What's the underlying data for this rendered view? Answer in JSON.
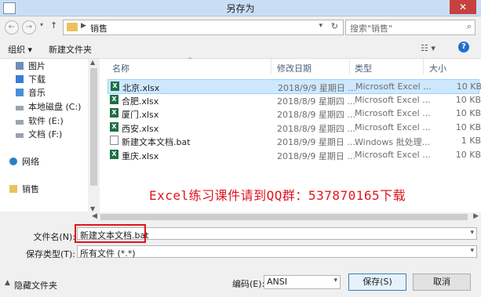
{
  "window": {
    "title": "另存为",
    "close_glyph": "✕"
  },
  "address": {
    "crumb": "销售",
    "search_placeholder": "搜索\"销售\""
  },
  "toolbar": {
    "organize": "组织 ▾",
    "new_folder": "新建文件夹"
  },
  "sidebar": {
    "items": [
      {
        "label": "图片",
        "icon": "pictures-icon"
      },
      {
        "label": "下载",
        "icon": "downloads-icon"
      },
      {
        "label": "音乐",
        "icon": "music-icon"
      },
      {
        "label": "本地磁盘 (C:)",
        "icon": "drive-icon"
      },
      {
        "label": "软件 (E:)",
        "icon": "drive-icon"
      },
      {
        "label": "文档 (F:)",
        "icon": "drive-icon"
      },
      {
        "label": "网络",
        "icon": "network-icon"
      },
      {
        "label": "销售",
        "icon": "folder-icon"
      }
    ]
  },
  "columns": {
    "name": "名称",
    "date": "修改日期",
    "type": "类型",
    "size": "大小"
  },
  "files": [
    {
      "name": "北京.xlsx",
      "date": "2018/9/9 星期日 ...",
      "type": "Microsoft Excel ...",
      "size": "10 KB",
      "kind": "excel",
      "selected": true
    },
    {
      "name": "合肥.xlsx",
      "date": "2018/8/9 星期四 ...",
      "type": "Microsoft Excel ...",
      "size": "10 KB",
      "kind": "excel"
    },
    {
      "name": "厦门.xlsx",
      "date": "2018/8/9 星期四 ...",
      "type": "Microsoft Excel ...",
      "size": "10 KB",
      "kind": "excel"
    },
    {
      "name": "西安.xlsx",
      "date": "2018/8/9 星期四 ...",
      "type": "Microsoft Excel ...",
      "size": "10 KB",
      "kind": "excel"
    },
    {
      "name": "新建文本文档.bat",
      "date": "2018/9/9 星期日 ...",
      "type": "Windows 批处理...",
      "size": "1 KB",
      "kind": "bat"
    },
    {
      "name": "重庆.xlsx",
      "date": "2018/9/9 星期日 ...",
      "type": "Microsoft Excel ...",
      "size": "10 KB",
      "kind": "excel"
    }
  ],
  "overlay_text": "Excel练习课件请到QQ群：537870165下载",
  "filename": {
    "label": "文件名(N):",
    "value": "新建文本文档.bat"
  },
  "filetype": {
    "label": "保存类型(T):",
    "value": "所有文件 (*.*)"
  },
  "footer": {
    "hide_folders": "隐藏文件夹",
    "encoding_label": "编码(E):",
    "encoding_value": "ANSI",
    "save": "保存(S)",
    "cancel": "取消"
  },
  "colors": {
    "overlay": "#e0141e",
    "excel": "#1d7044",
    "selection": "#cde8ff"
  }
}
